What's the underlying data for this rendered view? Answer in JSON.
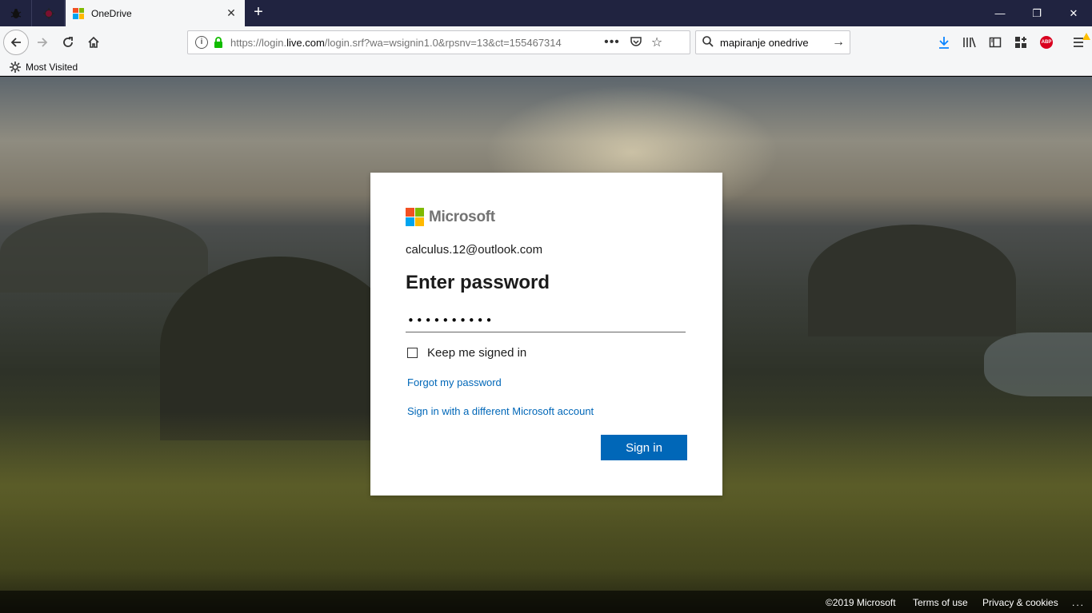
{
  "browser": {
    "tab": {
      "title": "OneDrive",
      "close_glyph": "✕"
    },
    "new_tab_glyph": "+",
    "window": {
      "minimize_glyph": "—",
      "maximize_glyph": "❐",
      "close_glyph": "✕"
    },
    "url": {
      "prefix": "https://login.",
      "host": "live.com",
      "rest": "/login.srf?wa=wsignin1.0&rpsnv=13&ct=155467314"
    },
    "url_more_glyph": "•••",
    "bookmark_star_glyph": "☆",
    "search": {
      "value": "mapiranje onedrive",
      "go_glyph": "→"
    },
    "abp_label": "ABP",
    "bookmarks": {
      "most_visited": "Most Visited"
    },
    "colors": {
      "tabstrip": "#202340",
      "toolbar": "#f5f6f7",
      "download_accent": "#0a84ff"
    }
  },
  "login": {
    "brand": "Microsoft",
    "identity": "calculus.12@outlook.com",
    "heading": "Enter password",
    "password_value": "••••••••••",
    "keep_signed_in": "Keep me signed in",
    "forgot_link": "Forgot my password",
    "different_account_link": "Sign in with a different Microsoft account",
    "sign_in_button": "Sign in",
    "colors": {
      "logo_red": "#f25022",
      "logo_green": "#7fba00",
      "logo_blue": "#00a4ef",
      "logo_yellow": "#ffb900",
      "primary": "#0067b8"
    }
  },
  "footer": {
    "copyright": "©2019 Microsoft",
    "terms": "Terms of use",
    "privacy": "Privacy & cookies",
    "more": "..."
  }
}
